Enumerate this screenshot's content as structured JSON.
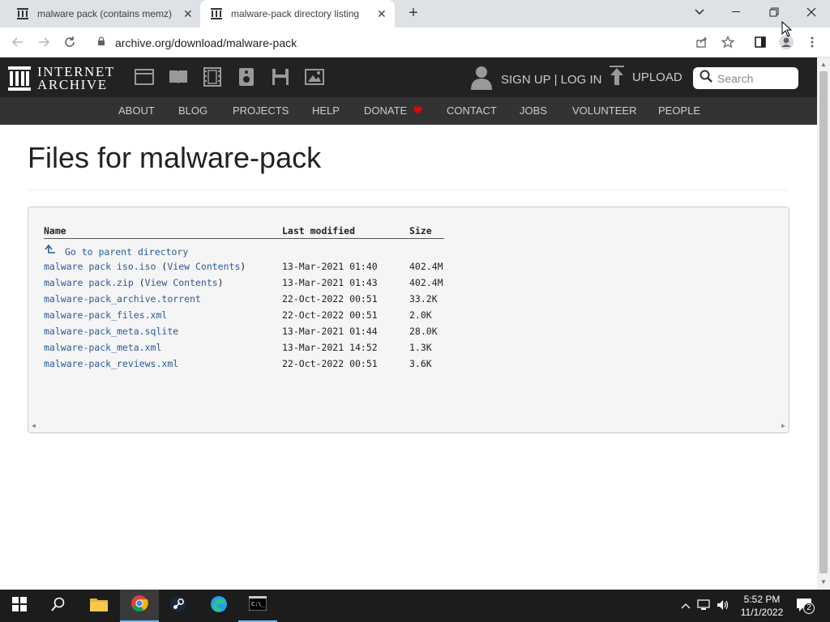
{
  "browser": {
    "tabs": [
      {
        "title": "malware pack (contains memz) :",
        "active": false
      },
      {
        "title": "malware-pack directory listing",
        "active": true
      }
    ],
    "url": "archive.org/download/malware-pack"
  },
  "ia_header": {
    "logo_line1": "INTERNET",
    "logo_line2": "ARCHIVE",
    "signup_label": "SIGN UP | LOG IN",
    "upload_label": "UPLOAD",
    "search_placeholder": "Search",
    "nav": [
      "ABOUT",
      "BLOG",
      "PROJECTS",
      "HELP",
      "DONATE",
      "CONTACT",
      "JOBS",
      "VOLUNTEER",
      "PEOPLE"
    ],
    "donate_heart_color": "#e00"
  },
  "page": {
    "title": "Files for malware-pack"
  },
  "listing": {
    "headers": {
      "name": "Name",
      "modified": "Last modified",
      "size": "Size"
    },
    "parent_label": "Go to parent directory",
    "rows": [
      {
        "name": "malware pack iso.iso",
        "contents": "View Contents",
        "modified": "13-Mar-2021 01:40",
        "size": "402.4M"
      },
      {
        "name": "malware pack.zip",
        "contents": "View Contents",
        "modified": "13-Mar-2021 01:43",
        "size": "402.4M"
      },
      {
        "name": "malware-pack_archive.torrent",
        "contents": "",
        "modified": "22-Oct-2022 00:51",
        "size": "33.2K"
      },
      {
        "name": "malware-pack_files.xml",
        "contents": "",
        "modified": "22-Oct-2022 00:51",
        "size": "2.0K"
      },
      {
        "name": "malware-pack_meta.sqlite",
        "contents": "",
        "modified": "13-Mar-2021 01:44",
        "size": "28.0K"
      },
      {
        "name": "malware-pack_meta.xml",
        "contents": "",
        "modified": "13-Mar-2021 14:52",
        "size": "1.3K"
      },
      {
        "name": "malware-pack_reviews.xml",
        "contents": "",
        "modified": "22-Oct-2022 00:51",
        "size": "3.6K"
      }
    ]
  },
  "taskbar": {
    "time": "5:52 PM",
    "date": "11/1/2022",
    "notification_count": "2"
  },
  "colors": {
    "link": "#2c5a9c",
    "ia_dark": "#222222",
    "ia_nav": "#333333"
  }
}
